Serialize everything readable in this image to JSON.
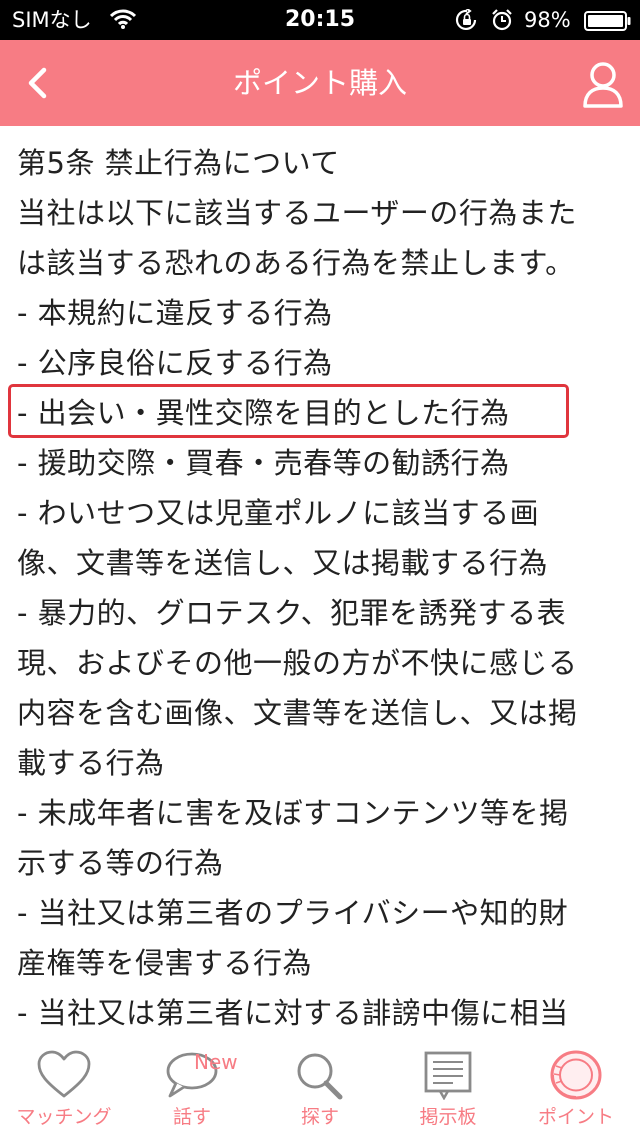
{
  "status_bar": {
    "carrier": "SIMなし",
    "time": "20:15",
    "battery": "98%"
  },
  "nav": {
    "title": "ポイント購入",
    "back_icon": "chevron-left-icon",
    "profile_icon": "person-icon"
  },
  "content": {
    "lines": [
      "第5条 禁止行為について",
      "当社は以下に該当するユーザーの行為また",
      "は該当する恐れのある行為を禁止します。",
      "- 本規約に違反する行為",
      "- 公序良俗に反する行為",
      "- 出会い・異性交際を目的とした行為",
      "- 援助交際・買春・売春等の勧誘行為",
      "- わいせつ又は児童ポルノに該当する画",
      "像、文書等を送信し、又は掲載する行為",
      "- 暴力的、グロテスク、犯罪を誘発する表",
      "現、およびその他一般の方が不快に感じる",
      "内容を含む画像、文書等を送信し、又は掲",
      "載する行為",
      "- 未成年者に害を及ぼすコンテンツ等を掲",
      "示する等の行為",
      "- 当社又は第三者のプライバシーや知的財",
      "産権等を侵害する行為",
      "- 当社又は第三者に対する誹謗中傷に相当"
    ]
  },
  "tabs": [
    {
      "label": "マッチング",
      "icon": "heart-icon"
    },
    {
      "label": "話す",
      "icon": "speech-bubble-icon",
      "badge": "New"
    },
    {
      "label": "探す",
      "icon": "magnifier-icon"
    },
    {
      "label": "掲示板",
      "icon": "bulletin-board-icon"
    },
    {
      "label": "ポイント",
      "icon": "coin-icon"
    }
  ],
  "colors": {
    "accent": "#f77c84",
    "highlight": "#e0353d",
    "text": "#222222",
    "icon_gray": "#8a8a8a"
  }
}
